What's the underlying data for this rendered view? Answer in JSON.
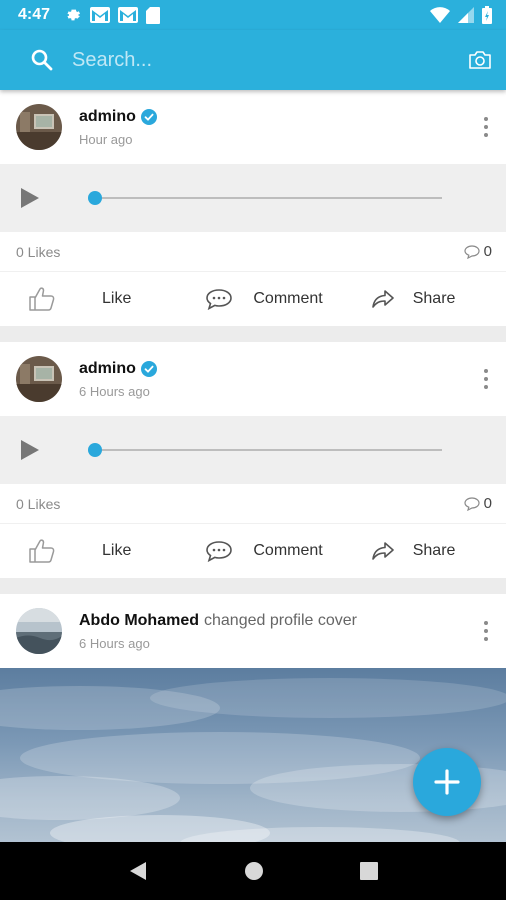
{
  "status_bar": {
    "time": "4:47"
  },
  "search": {
    "placeholder": "Search..."
  },
  "posts": [
    {
      "author": "admino",
      "verified": true,
      "time": "Hour ago",
      "likes": "0 Likes",
      "comments": "0",
      "like_label": "Like",
      "comment_label": "Comment",
      "share_label": "Share"
    },
    {
      "author": "admino",
      "verified": true,
      "time": "6 Hours ago",
      "likes": "0 Likes",
      "comments": "0",
      "like_label": "Like",
      "comment_label": "Comment",
      "share_label": "Share"
    },
    {
      "author": "Abdo Mohamed",
      "action": "changed profile cover",
      "time": "6 Hours ago"
    }
  ],
  "colors": {
    "primary": "#2bb0dc",
    "accent": "#2aa8dc"
  },
  "icons": [
    "settings-icon",
    "gmail-icon",
    "sd-card-icon",
    "wifi-icon",
    "signal-icon",
    "battery-icon",
    "search-icon",
    "camera-icon",
    "play-icon",
    "verified-icon",
    "more-icon",
    "like-icon",
    "comment-icon",
    "share-icon",
    "plus-icon",
    "back-icon",
    "home-icon",
    "recents-icon"
  ]
}
